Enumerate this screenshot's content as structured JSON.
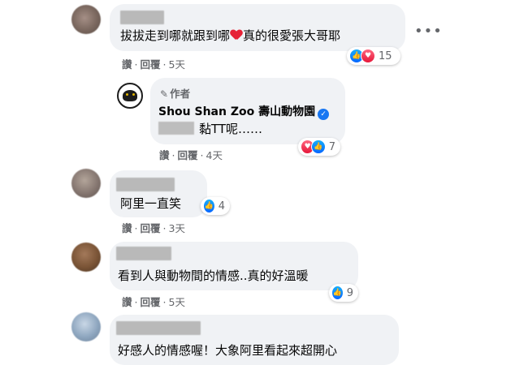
{
  "comments": [
    {
      "text_before": "拔拔走到哪就跟到哪",
      "text_after": "真的很愛張大哥耶",
      "actions": {
        "like": "讚",
        "reply": "回覆",
        "time": "5天"
      },
      "reaction_count": "15",
      "reactions": [
        "like-icon",
        "love-icon"
      ]
    },
    {
      "author_label": "作者",
      "author_name": "Shou Shan Zoo 壽山動物園",
      "text": "黏TT呢……",
      "actions": {
        "like": "讚",
        "reply": "回覆",
        "time": "4天"
      },
      "reaction_count": "7",
      "reactions": [
        "love-icon",
        "like-icon"
      ]
    },
    {
      "text": "阿里一直笑",
      "actions": {
        "like": "讚",
        "reply": "回覆",
        "time": "3天"
      },
      "reaction_count": "4",
      "reactions": [
        "like-icon"
      ]
    },
    {
      "text": "看到人與動物間的情感..真的好溫暖",
      "actions": {
        "like": "讚",
        "reply": "回覆",
        "time": "5天"
      },
      "reaction_count": "9",
      "reactions": [
        "like-icon"
      ]
    },
    {
      "text": "好感人的情感喔！大象阿里看起來超開心"
    }
  ],
  "more_menu": "•••",
  "colors": {
    "like": "#1877f2",
    "love": "#e62236",
    "bubble": "#f0f2f5",
    "meta": "#65676b"
  }
}
